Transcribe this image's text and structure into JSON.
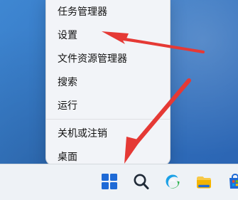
{
  "context_menu": {
    "items": [
      {
        "label": "任务管理器"
      },
      {
        "label": "设置"
      },
      {
        "label": "文件资源管理器"
      },
      {
        "label": "搜索"
      },
      {
        "label": "运行"
      },
      {
        "label": "关机或注销"
      },
      {
        "label": "桌面"
      }
    ]
  },
  "taskbar": {
    "icons": [
      {
        "name": "start"
      },
      {
        "name": "search"
      },
      {
        "name": "edge"
      },
      {
        "name": "file-explorer"
      },
      {
        "name": "store"
      }
    ]
  },
  "colors": {
    "accent": "#1e6ad6",
    "annotation": "#e53935",
    "menu_bg": "#f2f4f8",
    "taskbar_bg": "#eef2f6"
  }
}
